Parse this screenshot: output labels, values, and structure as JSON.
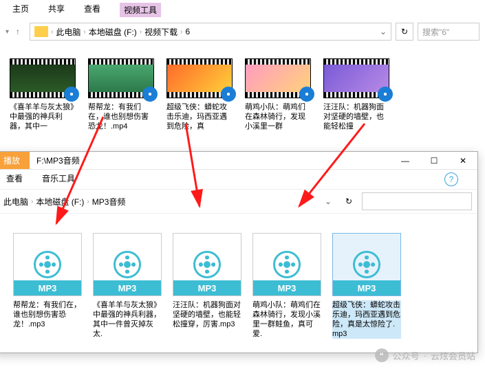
{
  "window1": {
    "tabs": {
      "home": "主页",
      "share": "共享",
      "view": "查看",
      "video_tools": "视频工具"
    },
    "breadcrumb": [
      "此电脑",
      "本地磁盘 (F:)",
      "视频下载",
      "6"
    ],
    "search_placeholder": "搜索\"6\"",
    "videos": [
      {
        "label": "《喜羊羊与灰太狼》中最强的神兵利器，其中一",
        "bg": "linear-gradient(180deg,#1c3a1a,#2b5a27)"
      },
      {
        "label": "帮帮龙：有我们在，谁也别想伤害恐龙！.mp4",
        "bg": "linear-gradient(180deg,#4aa66e,#2c7a4a)"
      },
      {
        "label": "超级飞侠：蟒蛇攻击乐迪，玛西亚遇到危险，真",
        "bg": "linear-gradient(135deg,#ff6a2a,#ffd13a)"
      },
      {
        "label": "萌鸡小队：萌鸡们在森林骑行，发现小溪里一群",
        "bg": "linear-gradient(135deg,#ff9cc0,#ffd27a)"
      },
      {
        "label": "汪汪队：机器狗面对坚硬的墙壁，也能轻松撞",
        "bg": "linear-gradient(135deg,#7a5ad6,#b78be6)"
      }
    ]
  },
  "window2": {
    "play_tab": "播放",
    "title": "F:\\MP3音频",
    "tabs": {
      "view": "查看",
      "music_tools": "音乐工具"
    },
    "breadcrumb": [
      "此电脑",
      "本地磁盘 (F:)",
      "MP3音频"
    ],
    "mp3_label": "MP3",
    "files": [
      {
        "label": "帮帮龙：有我们在，谁也别想伤害恐龙！.mp3",
        "selected": false
      },
      {
        "label": "《喜羊羊与灰太狼》中最强的神兵利器，其中一件曾灭掉灰太.",
        "selected": false
      },
      {
        "label": "汪汪队：机器狗面对坚硬的墙壁，也能轻松撞穿，厉害.mp3",
        "selected": false
      },
      {
        "label": "萌鸡小队：萌鸡们在森林骑行，发现小溪里一群鲑鱼，真可爱.",
        "selected": false
      },
      {
        "label": "超级飞侠：蟒蛇攻击乐迪，玛西亚遇到危险，真是太惊险了.mp3",
        "selected": true
      }
    ]
  },
  "watermark": {
    "prefix": "公众号",
    "name": "云炫会员站"
  }
}
